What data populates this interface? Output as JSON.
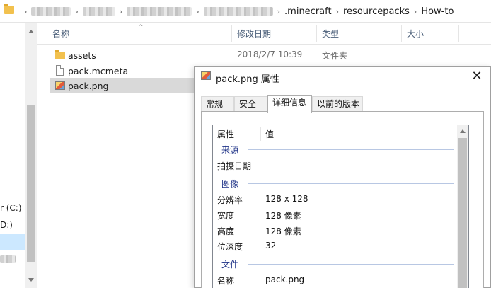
{
  "address": {
    "segments": [
      ".minecraft",
      "resourcepacks",
      "How-to"
    ]
  },
  "nav": {
    "items": [
      {
        "label": "r (C:)"
      },
      {
        "label": "D:)"
      }
    ]
  },
  "file_list": {
    "columns": [
      "名称",
      "修改日期",
      "类型",
      "大小"
    ],
    "rows": [
      {
        "name": "assets",
        "icon": "folder-icon",
        "date": "2018/2/7 10:39",
        "type": "文件夹"
      },
      {
        "name": "pack.mcmeta",
        "icon": "file-icon"
      },
      {
        "name": "pack.png",
        "icon": "image-file-icon"
      }
    ]
  },
  "dialog": {
    "title": "pack.png 属性",
    "close": "✕",
    "tabs": [
      "常规",
      "安全",
      "详细信息",
      "以前的版本"
    ],
    "active_tab": "详细信息",
    "columns": [
      "属性",
      "值"
    ],
    "groups": {
      "source": "来源",
      "image": "图像",
      "file": "文件"
    },
    "props": {
      "date_taken": {
        "key": "拍摄日期",
        "value": ""
      },
      "dimensions": {
        "key": "分辨率",
        "value": "128 x 128"
      },
      "width": {
        "key": "宽度",
        "value": "128 像素"
      },
      "height": {
        "key": "高度",
        "value": "128 像素"
      },
      "bit_depth": {
        "key": "位深度",
        "value": "32"
      },
      "name": {
        "key": "名称",
        "value": "pack.png"
      }
    }
  }
}
